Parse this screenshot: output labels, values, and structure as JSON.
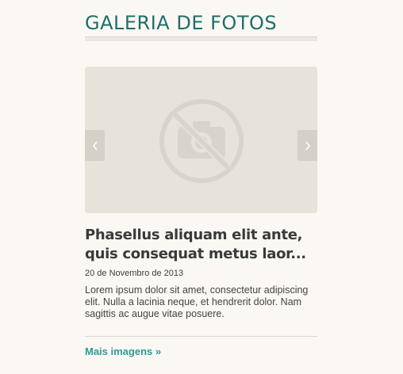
{
  "gallery": {
    "title": "GALERIA DE FOTOS",
    "image_placeholder_icon": "no-camera-icon",
    "prev_icon": "chevron-left-icon",
    "next_icon": "chevron-right-icon",
    "headline": "Phasellus aliquam elit ante, quis consequat metus laor...",
    "date": "20 de Novembro de 2013",
    "summary": "Lorem ipsum dolor sit amet, consectetur adipiscing elit. Nulla a lacinia neque, et hendrerit dolor. Nam sagittis ac augue vitae posuere.",
    "more_link": "Mais imagens »"
  },
  "colors": {
    "background": "#fbf8f3",
    "title": "#1f6e6c",
    "link": "#2a9c95",
    "slider_bg": "#e7e2da",
    "nav_button": "#d6d1c8"
  }
}
